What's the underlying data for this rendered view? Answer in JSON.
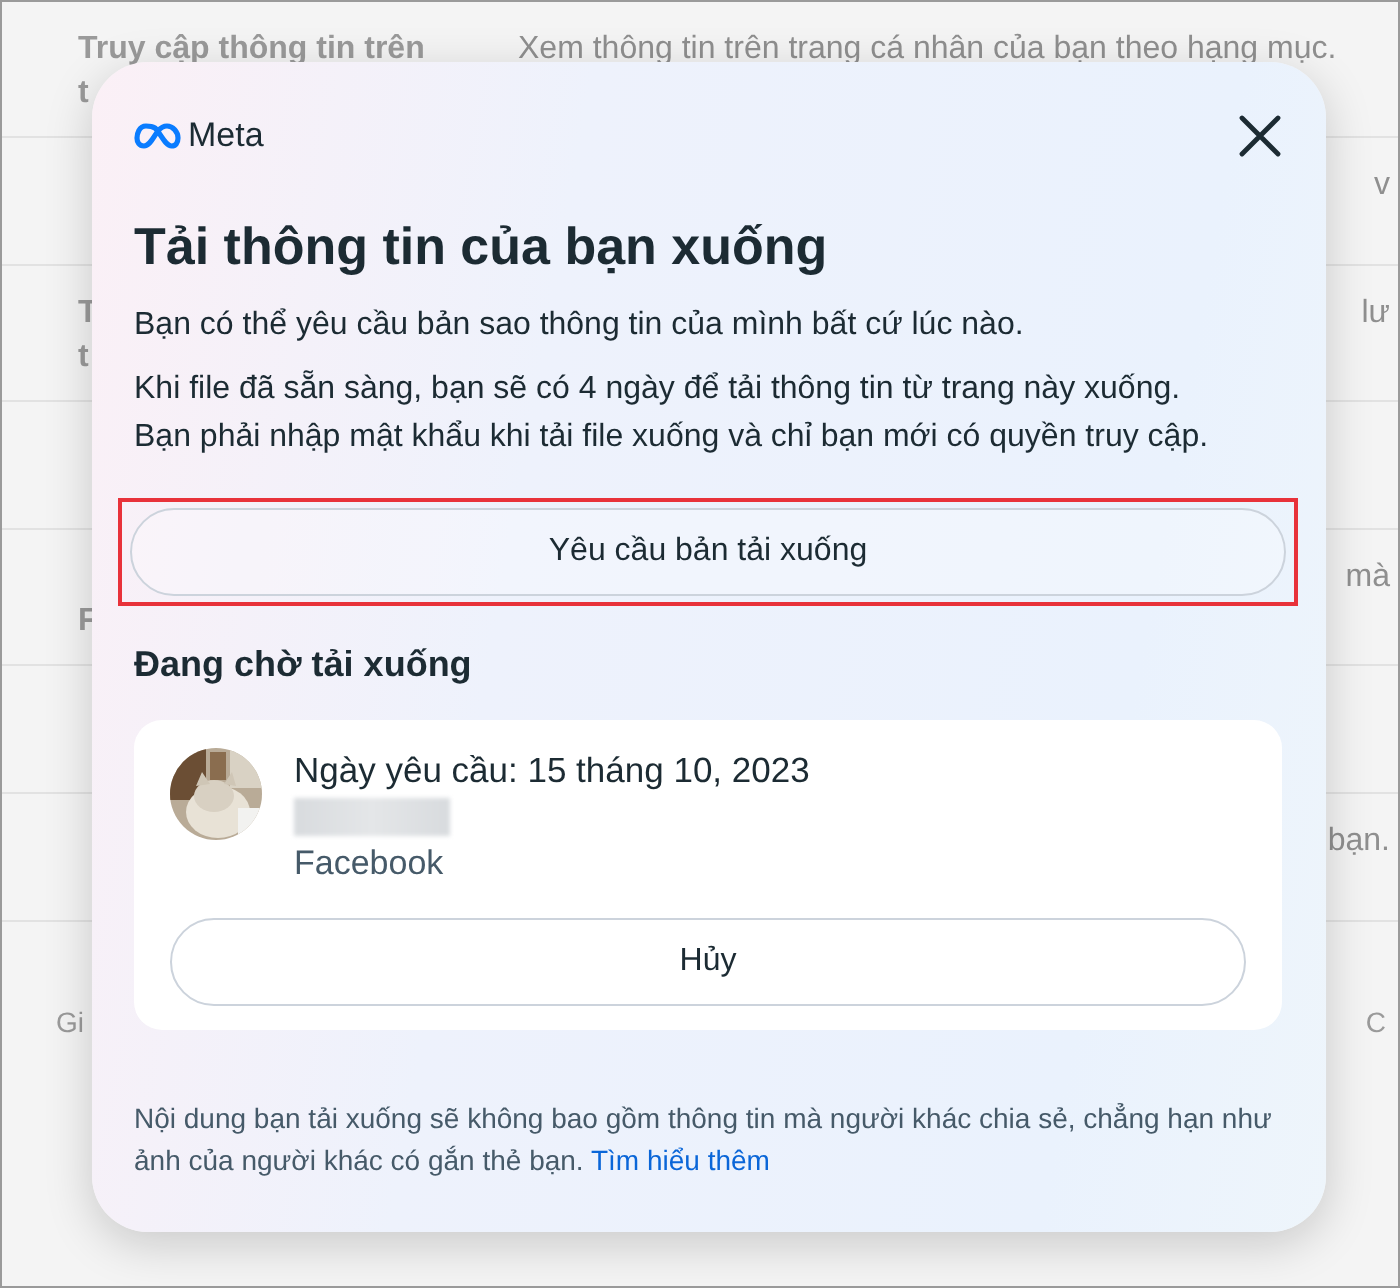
{
  "background_rows": [
    {
      "kind": "full",
      "label_lines": [
        "Truy cập thông tin trên",
        "t"
      ],
      "description": "Xem thông tin trên trang cá nhân của bạn theo hạng mục."
    },
    {
      "kind": "fragment",
      "description": "v"
    },
    {
      "kind": "fragment",
      "label_lines": [
        "T",
        "t"
      ],
      "description": "lư"
    },
    {
      "kind": "fragment"
    },
    {
      "kind": "fragment_low",
      "label_lines": [
        "F"
      ],
      "description": "mà"
    },
    {
      "kind": "fragment"
    },
    {
      "kind": "fragment",
      "description": "bạn."
    }
  ],
  "background_footer": {
    "left": "Gi",
    "right": "C"
  },
  "dialog": {
    "brand": "Meta",
    "title": "Tải thông tin của bạn xuống",
    "paragraphs": [
      "Bạn có thể yêu cầu bản sao thông tin của mình bất cứ lúc nào.",
      "Khi file đã sẵn sàng, bạn sẽ có 4 ngày để tải thông tin từ trang này xuống. Bạn phải nhập mật khẩu khi tải file xuống và chỉ bạn mới có quyền truy cập."
    ],
    "request_button": {
      "label": "Yêu cầu bản tải xuống",
      "highlighted": true
    },
    "pending_heading": "Đang chờ tải xuống",
    "pending_request": {
      "date": "Ngày yêu cầu: 15 tháng 10, 2023",
      "name_redacted": true,
      "source": "Facebook",
      "cancel_label": "Hủy"
    },
    "note": "Nội dung bạn tải xuống sẽ không bao gồm thông tin mà người khác chia sẻ, chẳng hạn như ảnh của người khác có gắn thẻ bạn.",
    "note_link": "Tìm hiểu thêm"
  }
}
